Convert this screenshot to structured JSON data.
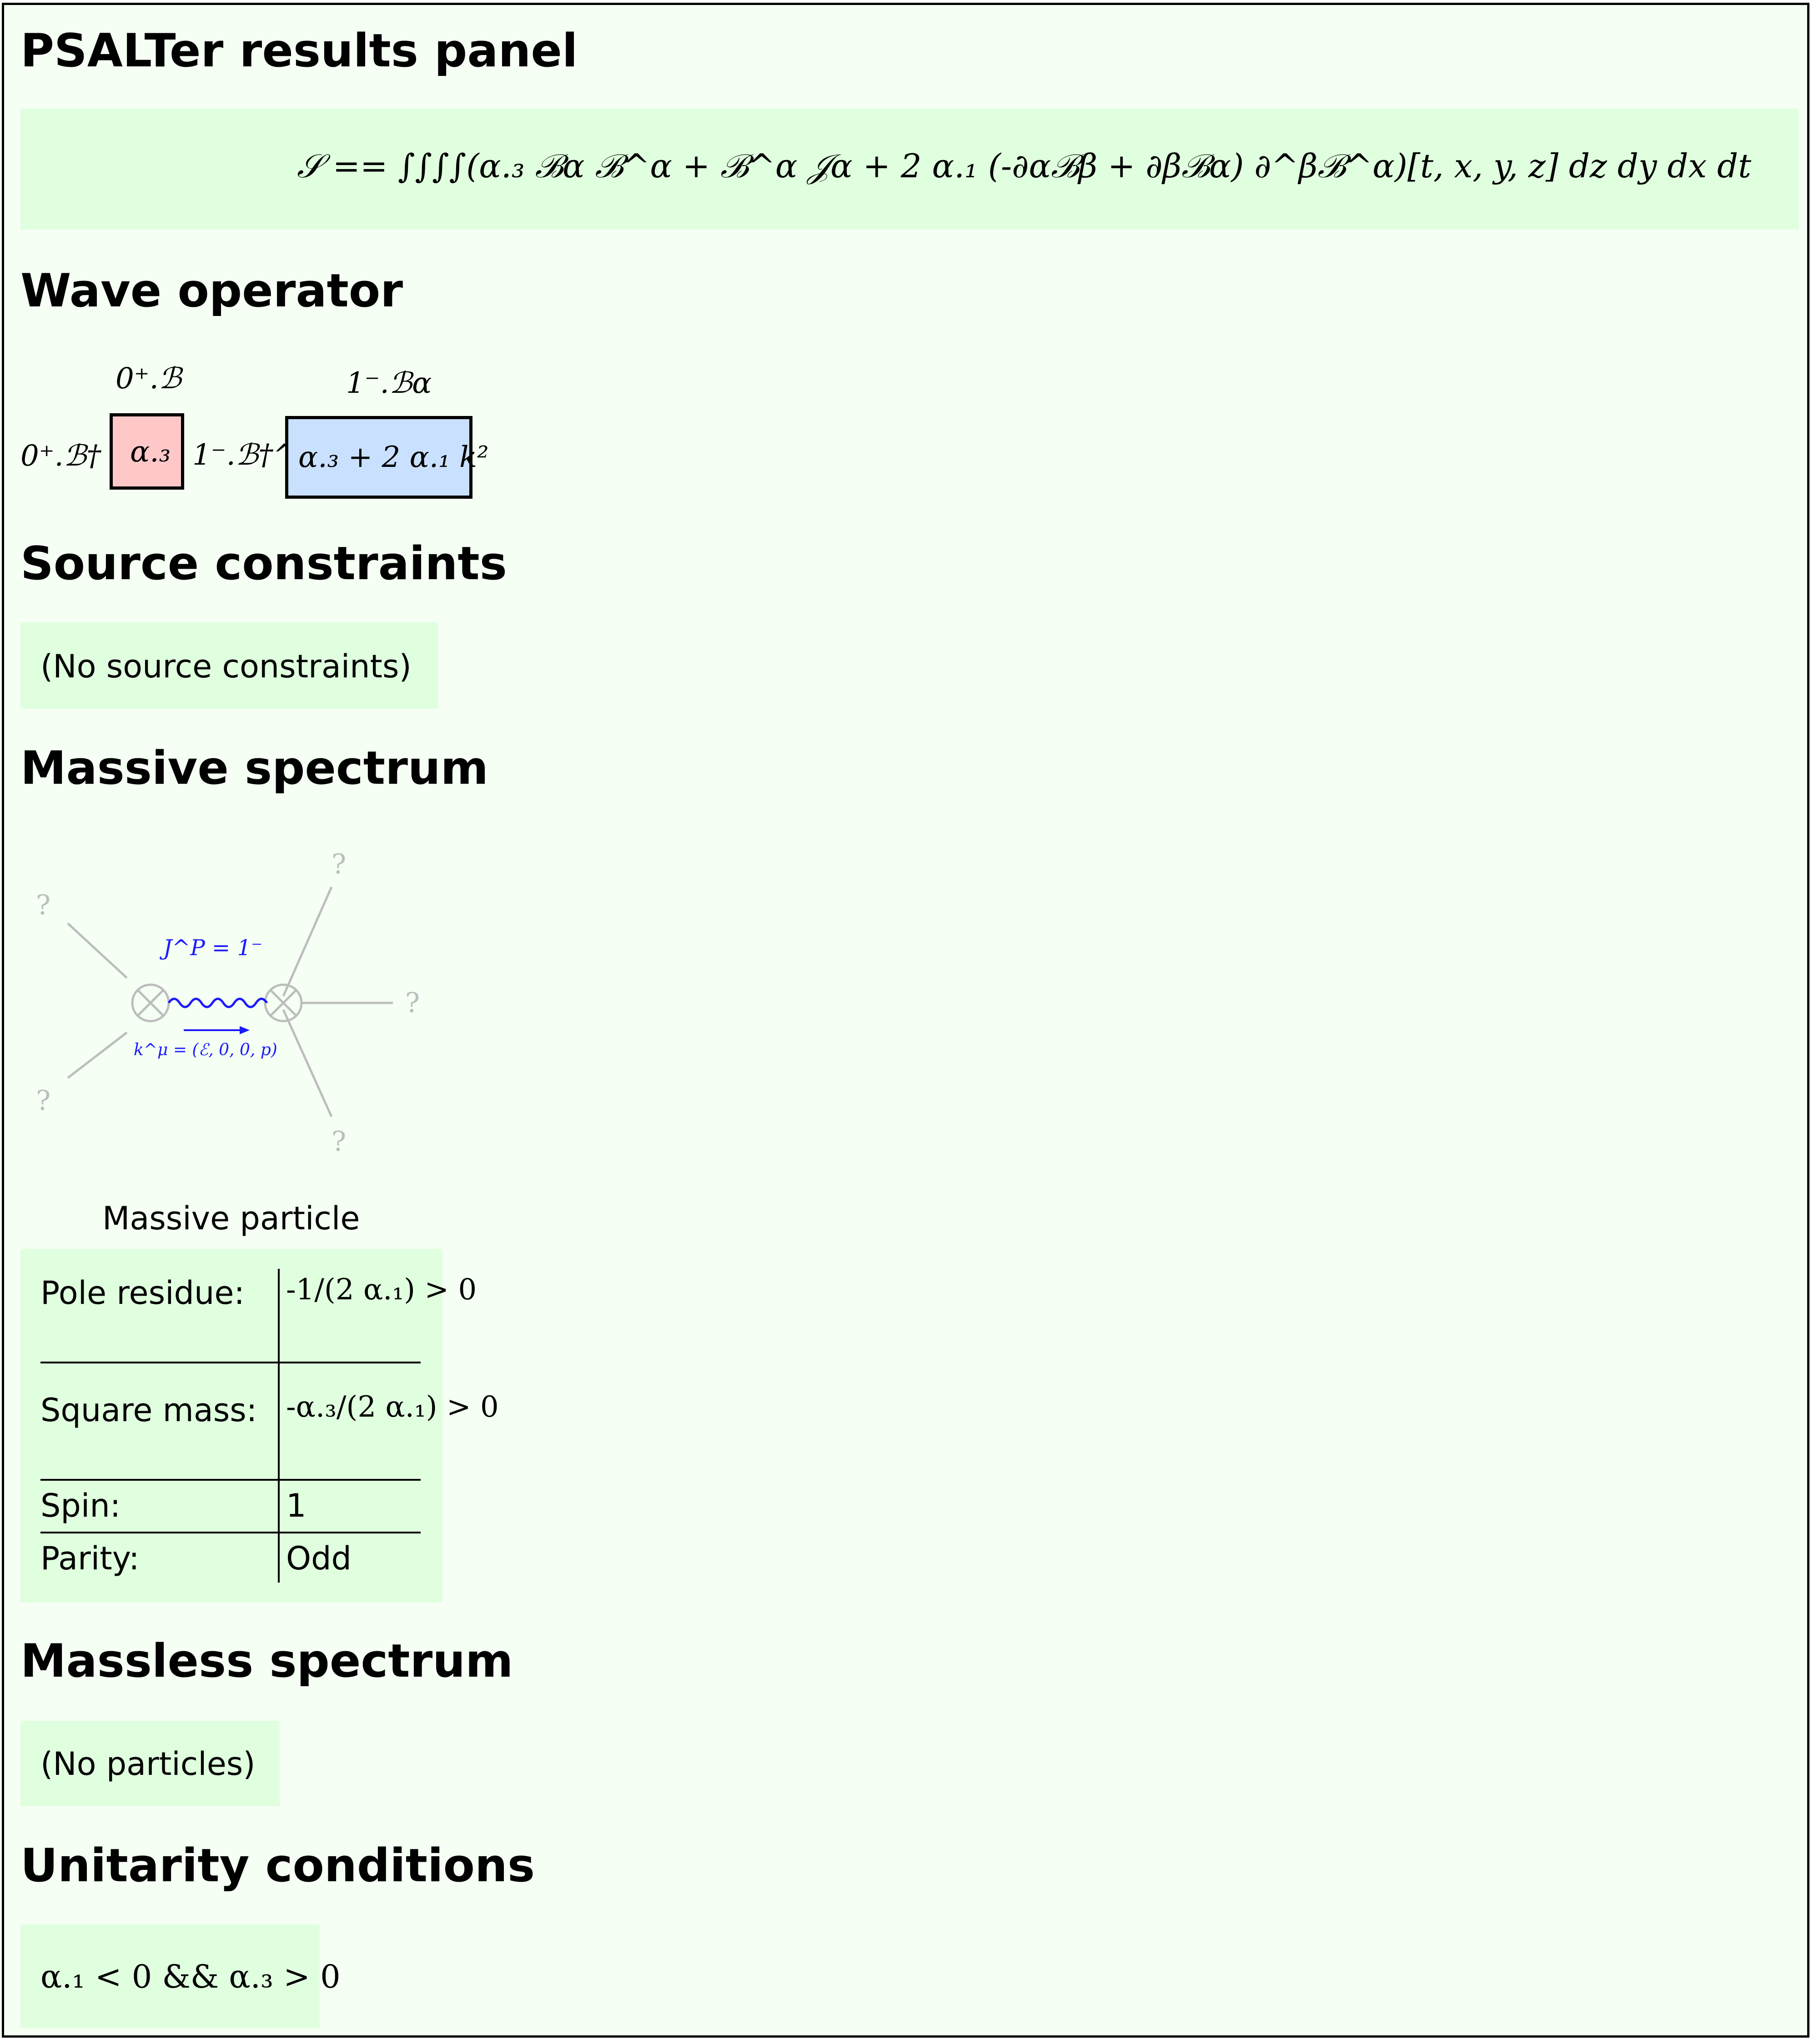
{
  "panel_title": "PSALTer results panel",
  "action": {
    "lhs": "𝒮 ==",
    "integrand": "∫∫∫∫(α.₃ ℬα ℬ^α + ℬ^α 𝒥α + 2 α.₁ (-∂αℬβ + ∂βℬα) ∂^βℬ^α)[t, x, y, z] dz dy dx dt"
  },
  "sections": {
    "wave_operator": "Wave operator",
    "source_constraints": "Source constraints",
    "massive_spectrum": "Massive spectrum",
    "massless_spectrum": "Massless spectrum",
    "unitarity_conditions": "Unitarity conditions"
  },
  "wave_operator": {
    "block_0plus": {
      "column": "0⁺.ℬ",
      "row": "0⁺.ℬ†",
      "entry": "α.₃",
      "color": "#ffc8c8"
    },
    "block_1minus": {
      "column": "1⁻.ℬα",
      "row": "1⁻.ℬ†^α",
      "entry": "α.₃ + 2 α.₁ k²",
      "color": "#c9e0ff"
    }
  },
  "source_constraints_text": "(No source constraints)",
  "massive": {
    "diagram": {
      "jp_label": "J^P = 1⁻",
      "momentum_label": "k^μ = (ℰ, 0, 0, p)",
      "unknown_mark": "?",
      "propagator_color": "#1a1aff",
      "leg_color": "#bdbdbd"
    },
    "particle_title": "Massive particle",
    "rows": [
      {
        "label": "Pole residue:",
        "value": "-1/(2 α.₁) > 0"
      },
      {
        "label": "Square mass:",
        "value": "-α.₃/(2 α.₁) > 0"
      },
      {
        "label": "Spin:",
        "value": "1"
      },
      {
        "label": "Parity:",
        "value": "Odd"
      }
    ]
  },
  "massless_text": "(No particles)",
  "unitarity_text": "α.₁ < 0 && α.₃ > 0"
}
